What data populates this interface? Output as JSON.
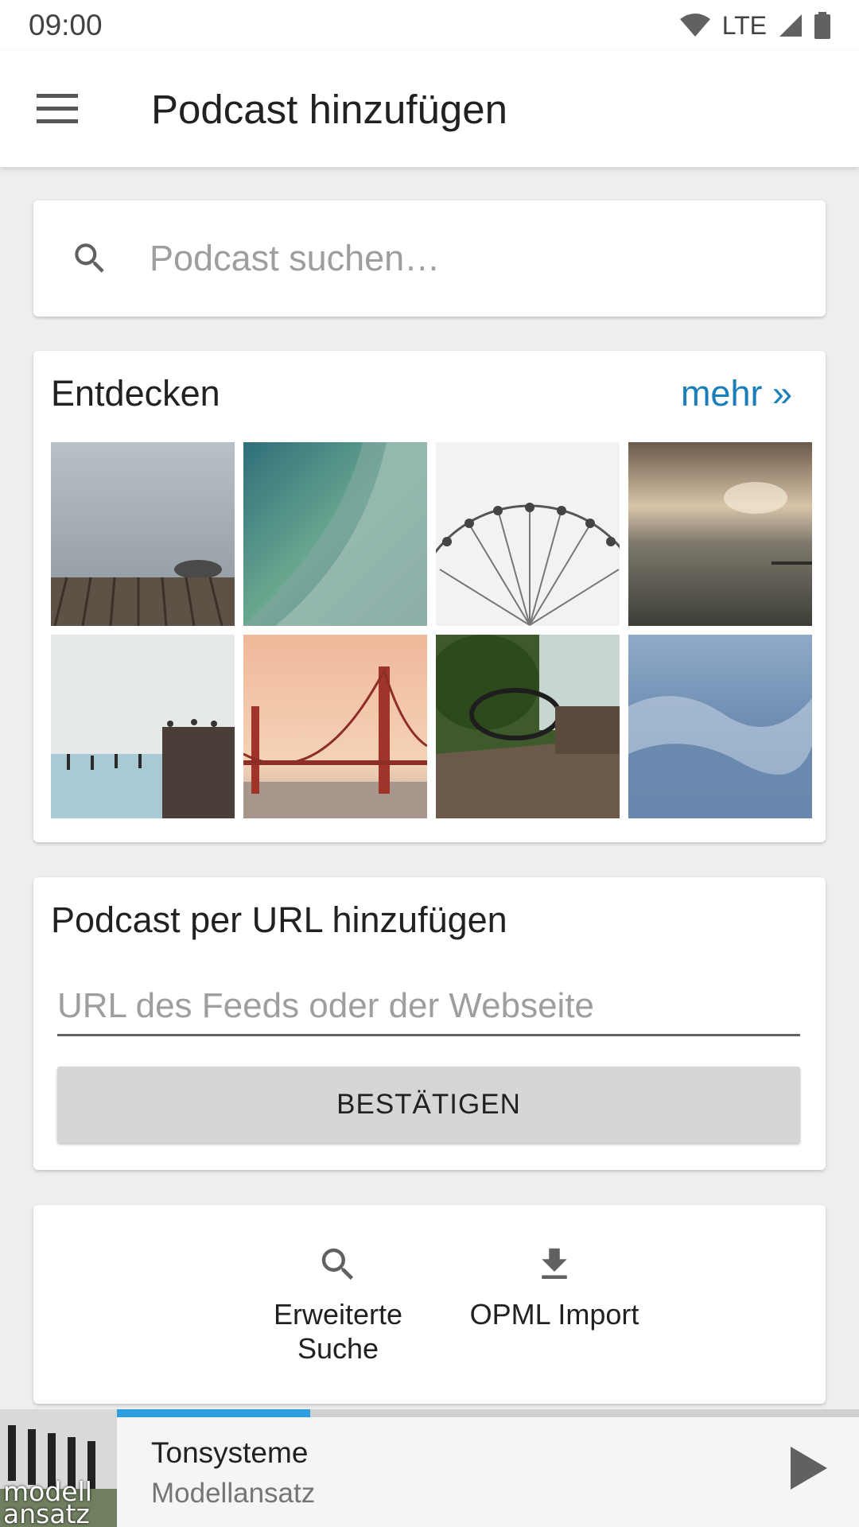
{
  "status_bar": {
    "time": "09:00",
    "network": "LTE",
    "icons": [
      "wifi-icon",
      "signal-icon",
      "battery-icon"
    ]
  },
  "app_bar": {
    "menu_icon": "hamburger-menu-icon",
    "title": "Podcast hinzufügen"
  },
  "search": {
    "icon": "search-icon",
    "placeholder": "Podcast suchen…"
  },
  "discover": {
    "title": "Entdecken",
    "more_label": "mehr »",
    "tiles": [
      {
        "name": "foggy-pier"
      },
      {
        "name": "ocean-wave"
      },
      {
        "name": "ferris-wheel"
      },
      {
        "name": "stormy-sea"
      },
      {
        "name": "birds-on-posts"
      },
      {
        "name": "golden-gate-bridge"
      },
      {
        "name": "old-truck-interior"
      },
      {
        "name": "aerial-mountains"
      }
    ]
  },
  "add_by_url": {
    "title": "Podcast per URL hinzufügen",
    "placeholder": "URL des Feeds oder der Webseite",
    "confirm_label": "BESTÄTIGEN"
  },
  "actions": {
    "advanced_search_label": "Erweiterte Suche",
    "advanced_search_icon": "search-icon",
    "opml_import_label": "OPML Import",
    "opml_import_icon": "download-icon"
  },
  "player": {
    "cover_text": "modell ansatz",
    "title": "Tonsysteme",
    "subtitle": "Modellansatz",
    "progress": 0.26,
    "play_icon": "play-icon"
  },
  "colors": {
    "accent": "#1a7fb9",
    "progress": "#2d9ee0",
    "background": "#eeeeee"
  }
}
